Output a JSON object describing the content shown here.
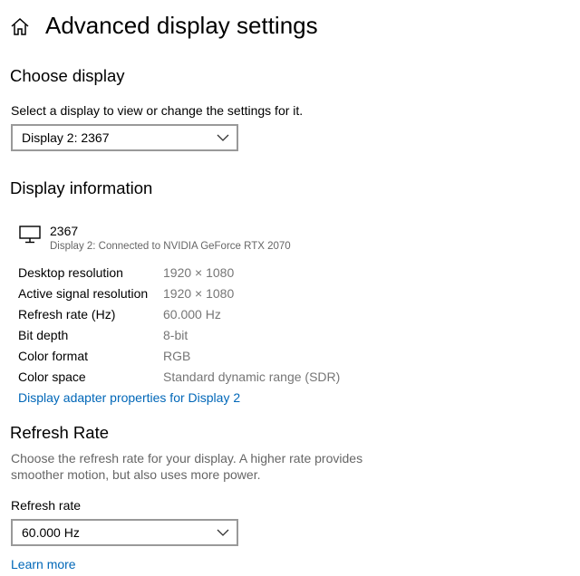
{
  "header": {
    "title": "Advanced display settings",
    "home_icon": "home-icon"
  },
  "choose_display": {
    "heading": "Choose display",
    "instruction": "Select a display to view or change the settings for it.",
    "selected": "Display 2: 2367"
  },
  "display_information": {
    "heading": "Display information",
    "icon": "monitor-icon",
    "display_name": "2367",
    "connection": "Display 2: Connected to NVIDIA GeForce RTX 2070",
    "rows": [
      {
        "label": "Desktop resolution",
        "value": "1920 × 1080"
      },
      {
        "label": "Active signal resolution",
        "value": "1920 × 1080"
      },
      {
        "label": "Refresh rate (Hz)",
        "value": "60.000 Hz"
      },
      {
        "label": "Bit depth",
        "value": "8-bit"
      },
      {
        "label": "Color format",
        "value": "RGB"
      },
      {
        "label": "Color space",
        "value": "Standard dynamic range (SDR)"
      }
    ],
    "adapter_link": "Display adapter properties for Display 2"
  },
  "refresh_rate": {
    "heading": "Refresh Rate",
    "description": "Choose the refresh rate for your display. A higher rate provides smoother motion, but also uses more power.",
    "field_label": "Refresh rate",
    "selected": "60.000 Hz",
    "learn_more": "Learn more"
  },
  "colors": {
    "link": "#0067b8",
    "secondary_text": "#767676",
    "dropdown_border": "#999999"
  }
}
